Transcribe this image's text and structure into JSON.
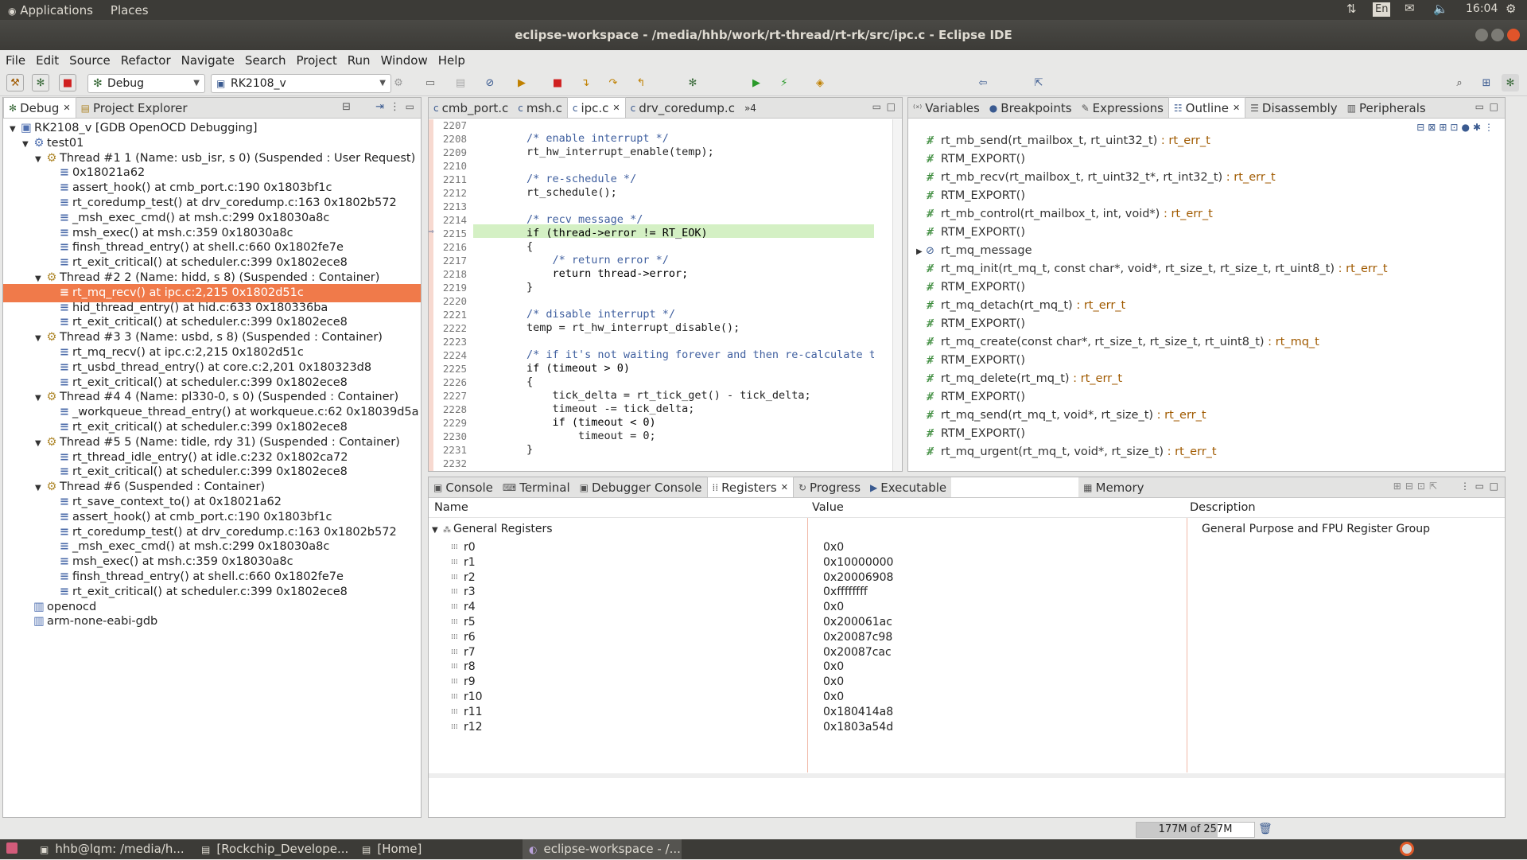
{
  "topbar": {
    "applications": "Applications",
    "places": "Places",
    "lang": "En",
    "clock": "16:04"
  },
  "window": {
    "title": "eclipse-workspace - /media/hhb/work/rt-thread/rt-rk/src/ipc.c - Eclipse IDE"
  },
  "menu": [
    "File",
    "Edit",
    "Source",
    "Refactor",
    "Navigate",
    "Search",
    "Project",
    "Run",
    "Window",
    "Help"
  ],
  "toolbar": {
    "perspective": "Debug",
    "launch_target": "RK2108_v"
  },
  "debug_panel": {
    "tabs": [
      "Debug",
      "Project Explorer"
    ],
    "rows": [
      {
        "t": "RK2108_v [GDB OpenOCD Debugging]",
        "lvl": 0,
        "k": "launch"
      },
      {
        "t": "test01",
        "lvl": 1,
        "k": "proc"
      },
      {
        "t": "Thread #1 1 (Name: usb_isr, s 0) (Suspended : User Request)",
        "lvl": 2,
        "k": "thread"
      },
      {
        "t": "0x18021a62",
        "lvl": 3,
        "k": "frame"
      },
      {
        "t": "assert_hook() at cmb_port.c:190 0x1803bf1c",
        "lvl": 3,
        "k": "frame"
      },
      {
        "t": "rt_coredump_test() at drv_coredump.c:163 0x1802b572",
        "lvl": 3,
        "k": "frame"
      },
      {
        "t": "_msh_exec_cmd() at msh.c:299 0x18030a8c",
        "lvl": 3,
        "k": "frame"
      },
      {
        "t": "msh_exec() at msh.c:359 0x18030a8c",
        "lvl": 3,
        "k": "frame"
      },
      {
        "t": "finsh_thread_entry() at shell.c:660 0x1802fe7e",
        "lvl": 3,
        "k": "frame"
      },
      {
        "t": "rt_exit_critical() at scheduler.c:399 0x1802ece8",
        "lvl": 3,
        "k": "frame"
      },
      {
        "t": "Thread #2 2 (Name: hidd, s 8) (Suspended : Container)",
        "lvl": 2,
        "k": "thread"
      },
      {
        "t": "rt_mq_recv() at ipc.c:2,215 0x1802d51c",
        "lvl": 3,
        "k": "frame",
        "sel": true
      },
      {
        "t": "hid_thread_entry() at hid.c:633 0x180336ba",
        "lvl": 3,
        "k": "frame"
      },
      {
        "t": "rt_exit_critical() at scheduler.c:399 0x1802ece8",
        "lvl": 3,
        "k": "frame"
      },
      {
        "t": "Thread #3 3 (Name: usbd, s 8) (Suspended : Container)",
        "lvl": 2,
        "k": "thread"
      },
      {
        "t": "rt_mq_recv() at ipc.c:2,215 0x1802d51c",
        "lvl": 3,
        "k": "frame"
      },
      {
        "t": "rt_usbd_thread_entry() at core.c:2,201 0x180323d8",
        "lvl": 3,
        "k": "frame"
      },
      {
        "t": "rt_exit_critical() at scheduler.c:399 0x1802ece8",
        "lvl": 3,
        "k": "frame"
      },
      {
        "t": "Thread #4 4 (Name: pl330-0, s 0) (Suspended : Container)",
        "lvl": 2,
        "k": "thread"
      },
      {
        "t": "_workqueue_thread_entry() at workqueue.c:62 0x18039d5a",
        "lvl": 3,
        "k": "frame"
      },
      {
        "t": "rt_exit_critical() at scheduler.c:399 0x1802ece8",
        "lvl": 3,
        "k": "frame"
      },
      {
        "t": "Thread #5 5 (Name: tidle, rdy 31) (Suspended : Container)",
        "lvl": 2,
        "k": "thread"
      },
      {
        "t": "rt_thread_idle_entry() at idle.c:232 0x1802ca72",
        "lvl": 3,
        "k": "frame"
      },
      {
        "t": "rt_exit_critical() at scheduler.c:399 0x1802ece8",
        "lvl": 3,
        "k": "frame"
      },
      {
        "t": "Thread #6 (Suspended : Container)",
        "lvl": 2,
        "k": "thread"
      },
      {
        "t": "rt_save_context_to() at 0x18021a62",
        "lvl": 3,
        "k": "frame"
      },
      {
        "t": "assert_hook() at cmb_port.c:190 0x1803bf1c",
        "lvl": 3,
        "k": "frame"
      },
      {
        "t": "rt_coredump_test() at drv_coredump.c:163 0x1802b572",
        "lvl": 3,
        "k": "frame"
      },
      {
        "t": "_msh_exec_cmd() at msh.c:299 0x18030a8c",
        "lvl": 3,
        "k": "frame"
      },
      {
        "t": "msh_exec() at msh.c:359 0x18030a8c",
        "lvl": 3,
        "k": "frame"
      },
      {
        "t": "finsh_thread_entry() at shell.c:660 0x1802fe7e",
        "lvl": 3,
        "k": "frame"
      },
      {
        "t": "rt_exit_critical() at scheduler.c:399 0x1802ece8",
        "lvl": 3,
        "k": "frame"
      },
      {
        "t": "openocd",
        "lvl": 1,
        "k": "proc2"
      },
      {
        "t": "arm-none-eabi-gdb",
        "lvl": 1,
        "k": "proc2"
      }
    ]
  },
  "editor": {
    "tabs": [
      "cmb_port.c",
      "msh.c",
      "ipc.c",
      "drv_coredump.c",
      "»4"
    ],
    "lines": [
      {
        "n": "2207",
        "c": ""
      },
      {
        "n": "2208",
        "c": "        /* enable interrupt */"
      },
      {
        "n": "2209",
        "c": "        rt_hw_interrupt_enable(temp);"
      },
      {
        "n": "2210",
        "c": ""
      },
      {
        "n": "2211",
        "c": "        /* re-schedule */"
      },
      {
        "n": "2212",
        "c": "        rt_schedule();"
      },
      {
        "n": "2213",
        "c": ""
      },
      {
        "n": "2214",
        "c": "        /* recv message */"
      },
      {
        "n": "2215",
        "c": "        if (thread->error != RT_EOK)"
      },
      {
        "n": "2216",
        "c": "        {"
      },
      {
        "n": "2217",
        "c": "            /* return error */"
      },
      {
        "n": "2218",
        "c": "            return thread->error;"
      },
      {
        "n": "2219",
        "c": "        }"
      },
      {
        "n": "2220",
        "c": ""
      },
      {
        "n": "2221",
        "c": "        /* disable interrupt */"
      },
      {
        "n": "2222",
        "c": "        temp = rt_hw_interrupt_disable();"
      },
      {
        "n": "2223",
        "c": ""
      },
      {
        "n": "2224",
        "c": "        /* if it's not waiting forever and then re-calculate tim"
      },
      {
        "n": "2225",
        "c": "        if (timeout > 0)"
      },
      {
        "n": "2226",
        "c": "        {"
      },
      {
        "n": "2227",
        "c": "            tick_delta = rt_tick_get() - tick_delta;"
      },
      {
        "n": "2228",
        "c": "            timeout -= tick_delta;"
      },
      {
        "n": "2229",
        "c": "            if (timeout < 0)"
      },
      {
        "n": "2230",
        "c": "                timeout = 0;"
      },
      {
        "n": "2231",
        "c": "        }"
      },
      {
        "n": "2232",
        "c": ""
      }
    ]
  },
  "outline_panel": {
    "tabs": [
      "Variables",
      "Breakpoints",
      "Expressions",
      "Outline",
      "Disassembly",
      "Peripherals"
    ],
    "items": [
      {
        "n": "rt_mb_send(rt_mailbox_t, rt_uint32_t)",
        "r": " : rt_err_t"
      },
      {
        "n": "RTM_EXPORT()",
        "r": ""
      },
      {
        "n": "rt_mb_recv(rt_mailbox_t, rt_uint32_t*, rt_int32_t)",
        "r": " : rt_err_t"
      },
      {
        "n": "RTM_EXPORT()",
        "r": ""
      },
      {
        "n": "rt_mb_control(rt_mailbox_t, int, void*)",
        "r": " : rt_err_t"
      },
      {
        "n": "RTM_EXPORT()",
        "r": ""
      },
      {
        "n": "rt_mq_message",
        "r": ""
      },
      {
        "n": "rt_mq_init(rt_mq_t, const char*, void*, rt_size_t, rt_size_t, rt_uint8_t)",
        "r": " : rt_err_t"
      },
      {
        "n": "RTM_EXPORT()",
        "r": ""
      },
      {
        "n": "rt_mq_detach(rt_mq_t)",
        "r": " : rt_err_t"
      },
      {
        "n": "RTM_EXPORT()",
        "r": ""
      },
      {
        "n": "rt_mq_create(const char*, rt_size_t, rt_size_t, rt_uint8_t)",
        "r": " : rt_mq_t"
      },
      {
        "n": "RTM_EXPORT()",
        "r": ""
      },
      {
        "n": "rt_mq_delete(rt_mq_t)",
        "r": " : rt_err_t"
      },
      {
        "n": "RTM_EXPORT()",
        "r": ""
      },
      {
        "n": "rt_mq_send(rt_mq_t, void*, rt_size_t)",
        "r": " : rt_err_t"
      },
      {
        "n": "RTM_EXPORT()",
        "r": ""
      },
      {
        "n": "rt_mq_urgent(rt_mq_t, void*, rt_size_t)",
        "r": " : rt_err_t"
      }
    ]
  },
  "bottom_panel": {
    "tabs": [
      "Console",
      "Terminal",
      "Debugger Console",
      "Registers",
      "Progress",
      "Executable",
      "Memory"
    ],
    "columns": [
      "Name",
      "Value",
      "Description"
    ],
    "group": {
      "name": "General Registers",
      "desc": "General Purpose and FPU Register Group"
    },
    "registers": [
      {
        "n": "r0",
        "v": "0x0"
      },
      {
        "n": "r1",
        "v": "0x10000000"
      },
      {
        "n": "r2",
        "v": "0x20006908"
      },
      {
        "n": "r3",
        "v": "0xffffffff"
      },
      {
        "n": "r4",
        "v": "0x0"
      },
      {
        "n": "r5",
        "v": "0x200061ac"
      },
      {
        "n": "r6",
        "v": "0x20087c98"
      },
      {
        "n": "r7",
        "v": "0x20087cac"
      },
      {
        "n": "r8",
        "v": "0x0"
      },
      {
        "n": "r9",
        "v": "0x0"
      },
      {
        "n": "r10",
        "v": "0x0"
      },
      {
        "n": "r11",
        "v": "0x180414a8"
      },
      {
        "n": "r12",
        "v": "0x1803a54d"
      }
    ]
  },
  "status": {
    "heap": "177M of 257M",
    "heap_fraction": 0.69
  },
  "taskbar": [
    "hhb@lqm: /media/h...",
    "[Rockchip_Develope...",
    "[Home]",
    "eclipse-workspace - /..."
  ]
}
